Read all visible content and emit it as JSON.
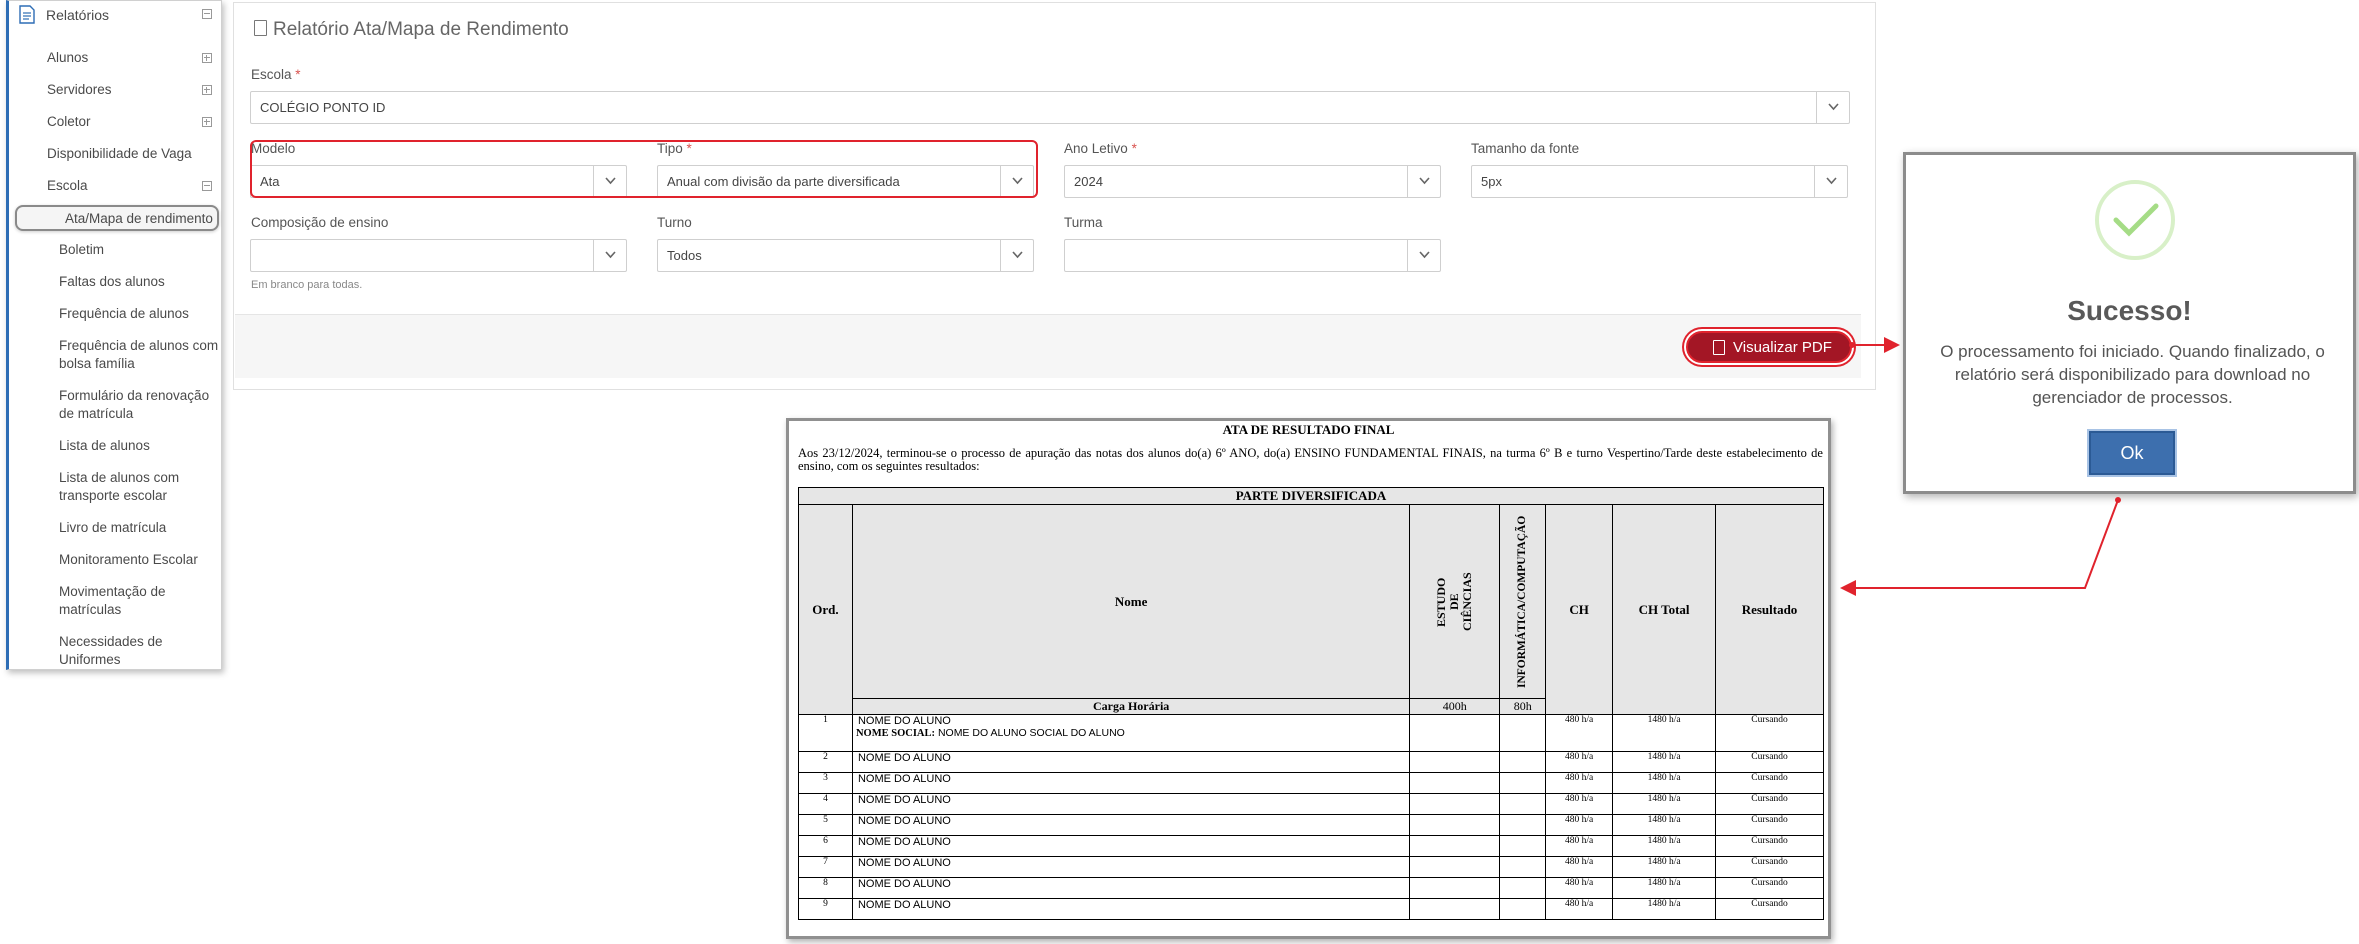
{
  "sidebar": {
    "header_label": "Relatórios",
    "items": [
      {
        "label": "Alunos"
      },
      {
        "label": "Servidores"
      },
      {
        "label": "Coletor"
      },
      {
        "label": "Disponibilidade de Vaga"
      },
      {
        "label": "Escola"
      }
    ],
    "subitems": [
      {
        "label": "Ata/Mapa de rendimento",
        "active": true
      },
      {
        "label": "Boletim"
      },
      {
        "label": "Faltas dos alunos"
      },
      {
        "label": "Frequência de alunos"
      },
      {
        "label": "Frequência de alunos com bolsa família"
      },
      {
        "label": "Formulário da renovação de matrícula"
      },
      {
        "label": "Lista de alunos"
      },
      {
        "label": "Lista de alunos com transporte escolar"
      },
      {
        "label": "Livro de matrícula"
      },
      {
        "label": "Monitoramento Escolar"
      },
      {
        "label": "Movimentação de matrículas"
      },
      {
        "label": "Necessidades de Uniformes"
      }
    ]
  },
  "form": {
    "title": "Relatório Ata/Mapa de Rendimento",
    "escola": {
      "label": "Escola",
      "required": "*",
      "value": "COLÉGIO PONTO ID"
    },
    "modelo": {
      "label": "Modelo",
      "value": "Ata"
    },
    "tipo": {
      "label": "Tipo",
      "required": "*",
      "value": "Anual com divisão da parte diversificada"
    },
    "ano_letivo": {
      "label": "Ano Letivo",
      "required": "*",
      "value": "2024"
    },
    "tamanho_fonte": {
      "label": "Tamanho da fonte",
      "value": "5px"
    },
    "composicao": {
      "label": "Composição de ensino",
      "value": "",
      "hint": "Em branco para todas."
    },
    "turno": {
      "label": "Turno",
      "value": "Todos"
    },
    "turma": {
      "label": "Turma",
      "value": ""
    },
    "pdf_button": "Visualizar PDF"
  },
  "modal": {
    "title": "Sucesso!",
    "message": "O processamento foi iniciado. Quando finalizado, o relatório será disponibilizado para download no gerenciador de processos.",
    "ok_button": "Ok"
  },
  "report": {
    "title": "ATA DE RESULTADO FINAL",
    "intro": "Aos 23/12/2024, terminou-se o processo de apuração das notas dos alunos do(a) 6º ANO, do(a) ENSINO FUNDAMENTAL FINAIS, na turma 6º B e turno Vespertino/Tarde deste estabelecimento de ensino, com os seguintes resultados:",
    "section_header": "PARTE DIVERSIFICADA",
    "columns": {
      "ord": "Ord.",
      "nome": "Nome",
      "disc1": "ESTUDO\nDE\nCIÊNCIAS",
      "disc2": "INFORMÁTICA/COMPUTAÇÃO",
      "ch": "CH",
      "ch_total": "CH Total",
      "resultado": "Resultado"
    },
    "carga_horaria": {
      "label": "Carga Horária",
      "disc1": "400h",
      "disc2": "80h"
    },
    "social_name_label": "NOME SOCIAL:",
    "social_name_value": "NOME DO ALUNO SOCIAL DO ALUNO",
    "rows": [
      {
        "ord": "1",
        "nome": "NOME DO ALUNO",
        "ch": "480 h/a",
        "ch_total": "1480 h/a",
        "resultado": "Cursando"
      },
      {
        "ord": "2",
        "nome": "NOME DO ALUNO",
        "ch": "480 h/a",
        "ch_total": "1480 h/a",
        "resultado": "Cursando"
      },
      {
        "ord": "3",
        "nome": "NOME DO ALUNO",
        "ch": "480 h/a",
        "ch_total": "1480 h/a",
        "resultado": "Cursando"
      },
      {
        "ord": "4",
        "nome": "NOME DO ALUNO",
        "ch": "480 h/a",
        "ch_total": "1480 h/a",
        "resultado": "Cursando"
      },
      {
        "ord": "5",
        "nome": "NOME DO ALUNO",
        "ch": "480 h/a",
        "ch_total": "1480 h/a",
        "resultado": "Cursando"
      },
      {
        "ord": "6",
        "nome": "NOME DO ALUNO",
        "ch": "480 h/a",
        "ch_total": "1480 h/a",
        "resultado": "Cursando"
      },
      {
        "ord": "7",
        "nome": "NOME DO ALUNO",
        "ch": "480 h/a",
        "ch_total": "1480 h/a",
        "resultado": "Cursando"
      },
      {
        "ord": "8",
        "nome": "NOME DO ALUNO",
        "ch": "480 h/a",
        "ch_total": "1480 h/a",
        "resultado": "Cursando"
      },
      {
        "ord": "9",
        "nome": "NOME DO ALUNO",
        "ch": "480 h/a",
        "ch_total": "1480 h/a",
        "resultado": "Cursando"
      }
    ]
  },
  "colors": {
    "accent": "#2d6db5",
    "highlight": "#e0232d",
    "pdf_button": "#a31625",
    "ok_button": "#3d6fae",
    "success": "#a5dc86"
  }
}
